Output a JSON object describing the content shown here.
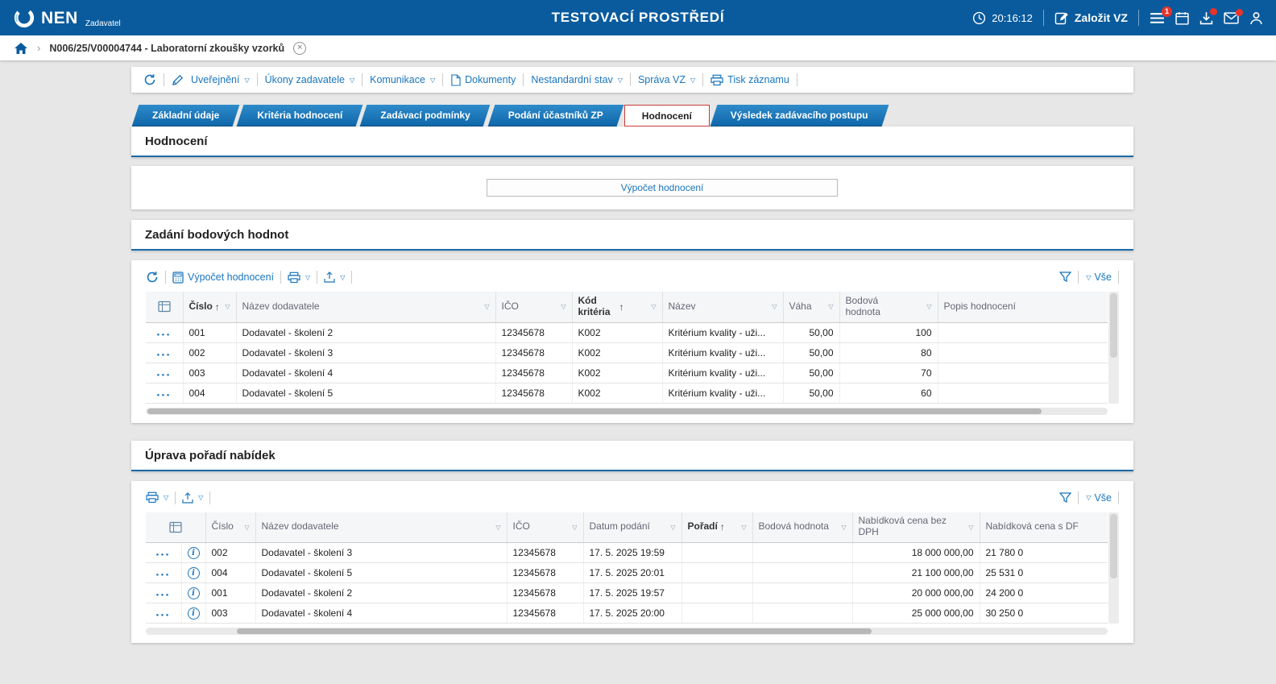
{
  "topbar": {
    "brand": "NEN",
    "brand_sub": "Zadavatel",
    "env_title": "TESTOVACÍ PROSTŘEDÍ",
    "time": "20:16:12",
    "create_vz_label": "Založit VZ",
    "menu_badge": "1"
  },
  "breadcrumb": {
    "item": "N006/25/V00004744 - Laboratorní zkoušky vzorků"
  },
  "actionbar": {
    "uverejneni": "Uveřejnění",
    "ukony": "Úkony zadavatele",
    "komunikace": "Komunikace",
    "dokumenty": "Dokumenty",
    "nestandardni": "Nestandardní stav",
    "sprava": "Správa VZ",
    "tisk": "Tisk záznamu"
  },
  "tabs": [
    "Základní údaje",
    "Kritéria hodnocení",
    "Zadávací podmínky",
    "Podání účastníků ZP",
    "Hodnocení",
    "Výsledek zadávacího postupu"
  ],
  "hodnoceni": {
    "title": "Hodnocení",
    "vypocet_button": "Výpočet hodnocení"
  },
  "t1": {
    "title": "Zadání bodových hodnot",
    "vypocet_link": "Výpočet hodnocení",
    "vse": "Vše",
    "h": {
      "cislo": "Číslo",
      "dodavatel": "Název dodavatele",
      "ico": "IČO",
      "kod": "Kód kritéria",
      "nazev": "Název",
      "vaha": "Váha",
      "body": "Bodová hodnota",
      "popis": "Popis hodnocení"
    },
    "rows": [
      {
        "cislo": "001",
        "dodavatel": "Dodavatel - školení 2",
        "ico": "12345678",
        "kod": "K002",
        "nazev": "Kritérium kvality - uži...",
        "vaha": "50,00",
        "body": "100"
      },
      {
        "cislo": "002",
        "dodavatel": "Dodavatel - školení 3",
        "ico": "12345678",
        "kod": "K002",
        "nazev": "Kritérium kvality - uži...",
        "vaha": "50,00",
        "body": "80"
      },
      {
        "cislo": "003",
        "dodavatel": "Dodavatel - školení 4",
        "ico": "12345678",
        "kod": "K002",
        "nazev": "Kritérium kvality - uži...",
        "vaha": "50,00",
        "body": "70"
      },
      {
        "cislo": "004",
        "dodavatel": "Dodavatel - školení 5",
        "ico": "12345678",
        "kod": "K002",
        "nazev": "Kritérium kvality - uži...",
        "vaha": "50,00",
        "body": "60"
      }
    ]
  },
  "t2": {
    "title": "Úprava pořadí nabídek",
    "vse": "Vše",
    "h": {
      "cislo": "Číslo",
      "dodavatel": "Název dodavatele",
      "ico": "IČO",
      "datum": "Datum podání",
      "poradi": "Pořadí",
      "body": "Bodová hodnota",
      "cena_bez": "Nabídková cena bez DPH",
      "cena_s": "Nabídková cena s DF"
    },
    "rows": [
      {
        "cislo": "002",
        "dodavatel": "Dodavatel - školení 3",
        "ico": "12345678",
        "datum": "17. 5. 2025 19:59",
        "cena_bez": "18 000 000,00",
        "cena_s": "21 780 0"
      },
      {
        "cislo": "004",
        "dodavatel": "Dodavatel - školení 5",
        "ico": "12345678",
        "datum": "17. 5. 2025 20:01",
        "cena_bez": "21 100 000,00",
        "cena_s": "25 531 0"
      },
      {
        "cislo": "001",
        "dodavatel": "Dodavatel - školení 2",
        "ico": "12345678",
        "datum": "17. 5. 2025 19:57",
        "cena_bez": "20 000 000,00",
        "cena_s": "24 200 0"
      },
      {
        "cislo": "003",
        "dodavatel": "Dodavatel - školení 4",
        "ico": "12345678",
        "datum": "17. 5. 2025 20:00",
        "cena_bez": "25 000 000,00",
        "cena_s": "30 250 0"
      }
    ]
  }
}
